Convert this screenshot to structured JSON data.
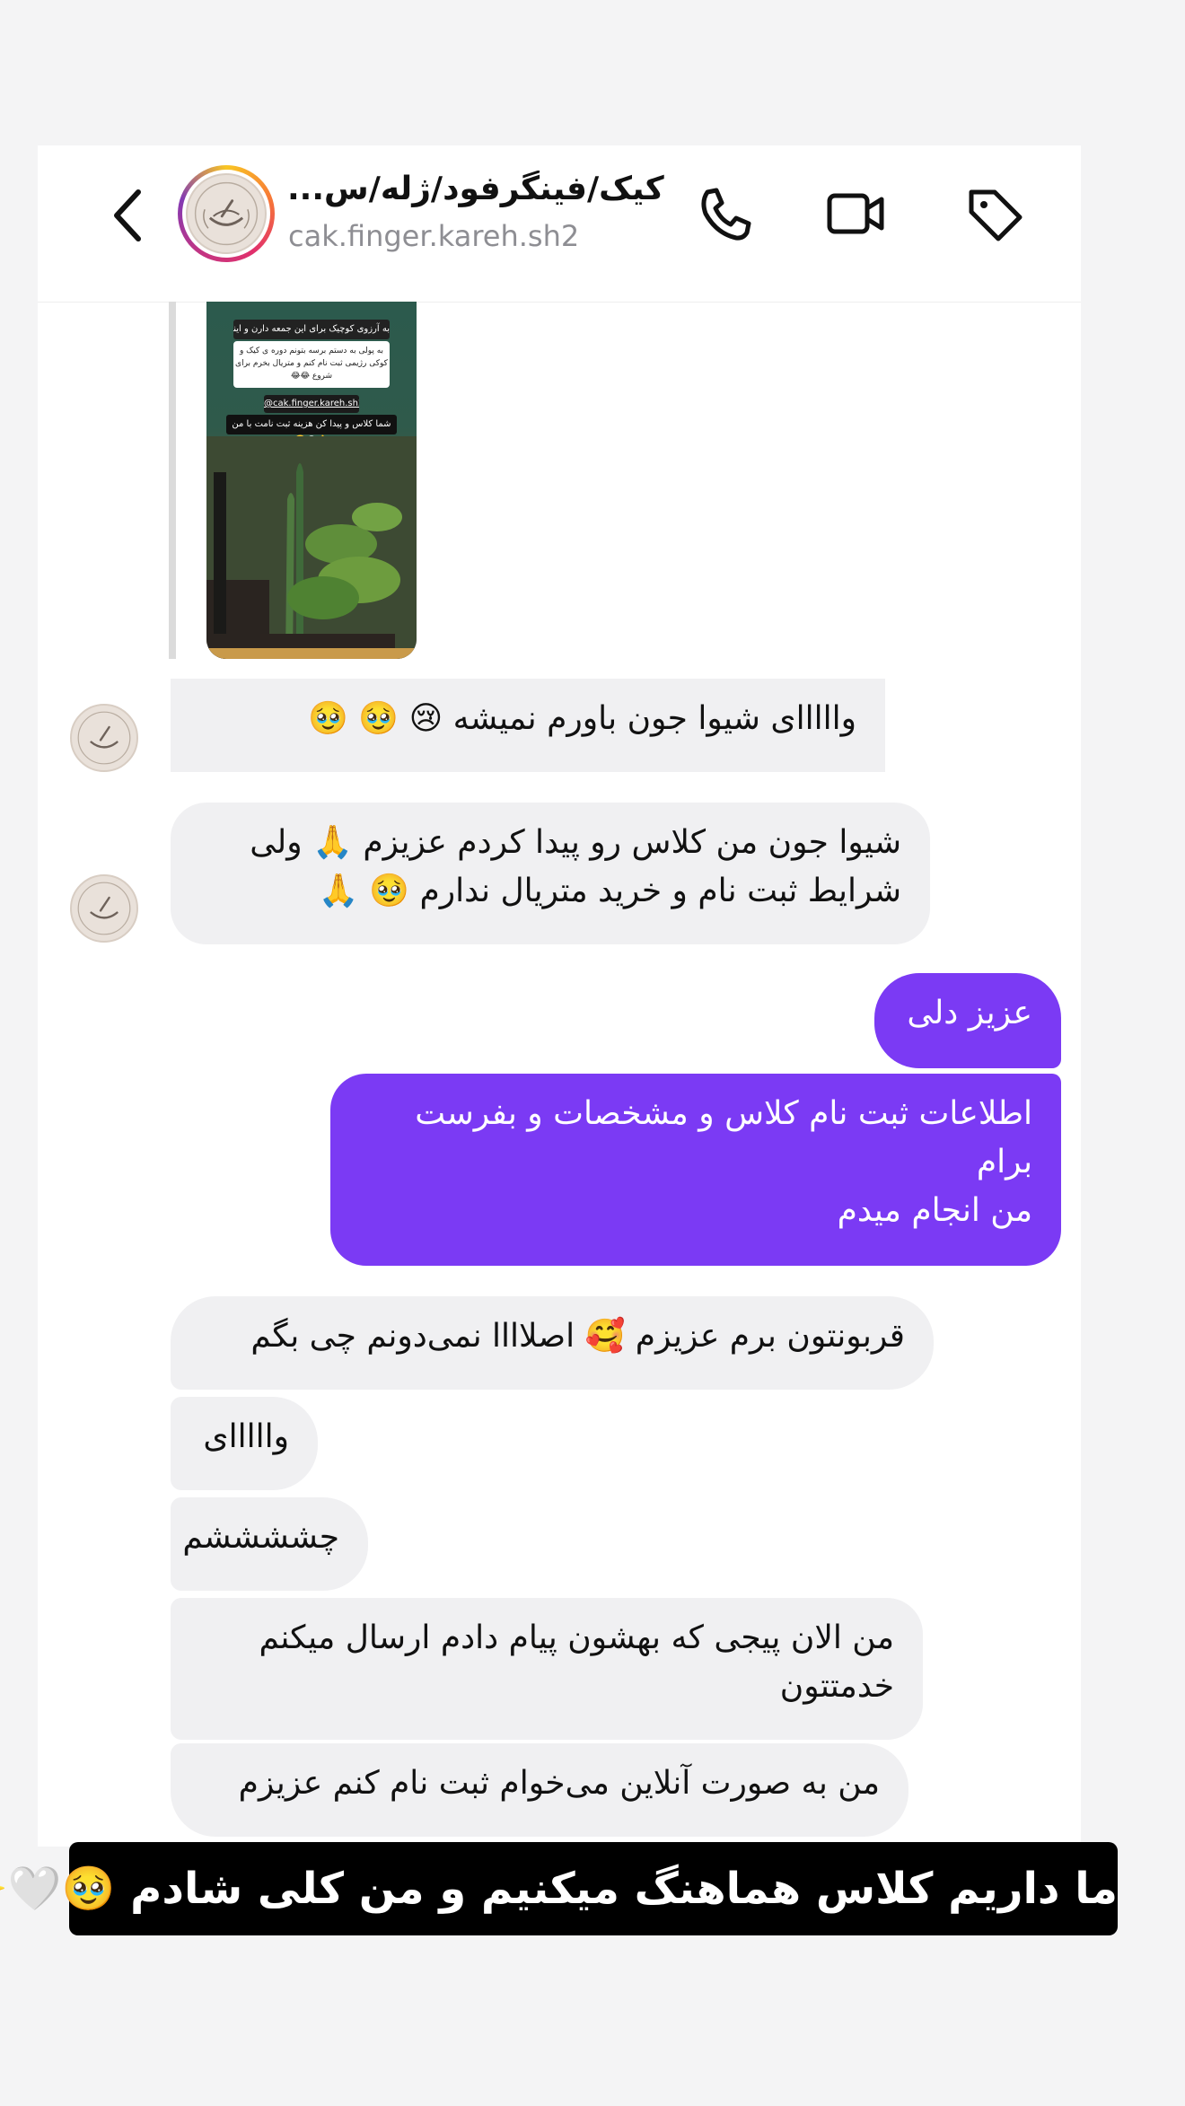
{
  "header": {
    "title": "کیک/فینگرفود/ژله/س...",
    "handle": "cak.finger.kareh.sh2",
    "back_icon": "chevron-left-icon",
    "call_icon": "phone-icon",
    "video_icon": "video-camera-icon",
    "tag_icon": "tag-icon"
  },
  "story": {
    "top_text": "به آرزوی کوچیک برای این جمعه دارن و اینجا بنویس 😅",
    "box_text": "به پولی به دستم برسه بتونم دوره ی کیک و کوکی رژیمی ثبت نام کنم و متریال بخرم برای شروع 😂😂",
    "mention": "@cak.finger.kareh.sh2",
    "caption": "شما کلاس و پیدا کن هزینه ثبت نامت با من",
    "emoji": "🥹😘👌"
  },
  "messages": {
    "m1": "وااااای شیوا جون باورم نمیشه 😢 🥹 🥹",
    "m2": "شیوا جون من کلاس رو پیدا کردم عزیزم 🙏 ولی\nشرایط ثبت نام و خرید متریال ندارم 🥹 🙏",
    "m3": "عزیز دلی",
    "m4": "اطلاعات ثبت نام کلاس و مشخصات و بفرست\nبرام\nمن انجام میدم",
    "m5": "قربونتون برم عزیزم 🥰 اصلاااا نمی‌دونم چی بگم",
    "m6": "وااااای",
    "m7": "چششششم",
    "m8": "من الان پیجی که بهشون پیام دادم ارسال میکنم\nخدمتتون",
    "m9": "من به صورت آنلاین می‌خوام ثبت نام کنم عزیزم"
  },
  "caption": "ما داریم کلاس هماهنگ میکنیم و من کلی شادم 🥹🤍✨",
  "colors": {
    "outgoing_bubble": "#7b3af4",
    "incoming_bubble": "#f0f0f2"
  }
}
